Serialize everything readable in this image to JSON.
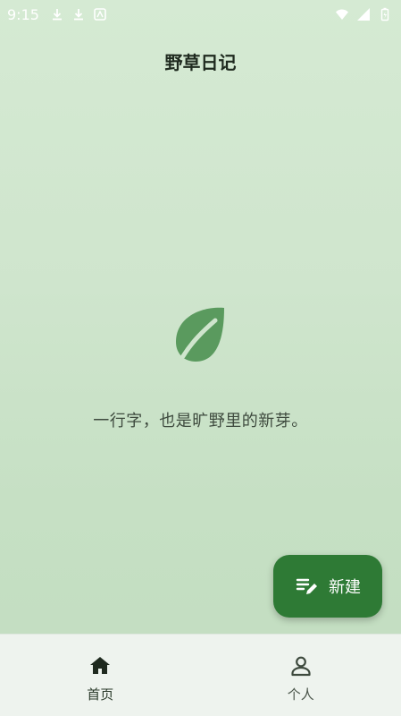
{
  "status_bar": {
    "time": "9:15",
    "left_icons": [
      "download-icon",
      "download-icon",
      "app-notification-icon"
    ],
    "right_icons": [
      "wifi-icon",
      "signal-icon",
      "battery-icon"
    ]
  },
  "header": {
    "title": "野草日记"
  },
  "empty_state": {
    "icon": "leaf-icon",
    "message": "一行字，也是旷野里的新芽。"
  },
  "fab": {
    "icon": "edit-note-icon",
    "label": "新建"
  },
  "bottom_nav": {
    "items": [
      {
        "icon": "home-icon",
        "label": "首页",
        "active": true
      },
      {
        "icon": "person-icon",
        "label": "个人",
        "active": false
      }
    ]
  },
  "colors": {
    "accent": "#2e7a35",
    "leaf": "#5a9a5e",
    "background": "#cfe5cd",
    "nav_background": "#eef3ee"
  }
}
